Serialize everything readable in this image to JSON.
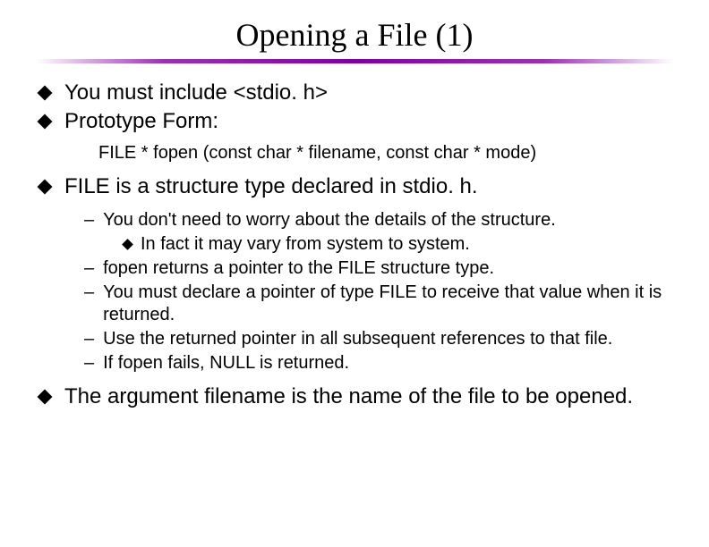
{
  "title": "Opening a File (1)",
  "b1": "You must include <stdio. h>",
  "b2": "Prototype Form:",
  "code": "FILE * fopen (const char * filename, const char * mode)",
  "b3": "FILE is a structure type declared in stdio. h.",
  "s1": "You don't need to worry about the details of the structure.",
  "s1a": "In fact it may vary from system to system.",
  "s2": "fopen returns a pointer to the FILE structure type.",
  "s3": "You must declare a pointer of type FILE to receive that value when it is returned.",
  "s4": "Use the returned pointer in all subsequent references to that file.",
  "s5": "If fopen fails, NULL is returned.",
  "b4": "The argument filename is the name of the file to be opened."
}
